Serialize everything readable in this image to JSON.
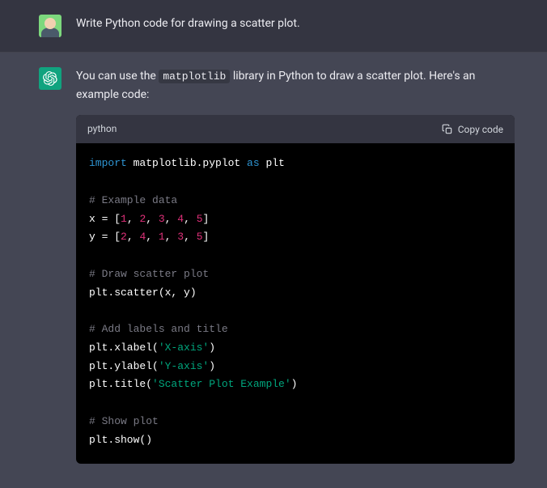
{
  "user": {
    "text": "Write Python code for drawing a scatter plot."
  },
  "assistant": {
    "intro_pre": "You can use the ",
    "intro_code": "matplotlib",
    "intro_post": " library in Python to draw a scatter plot. Here's an example code:"
  },
  "code_block": {
    "language": "python",
    "copy_label": "Copy code",
    "tokens": [
      [
        {
          "t": "import ",
          "c": "tok-keyword"
        },
        {
          "t": "matplotlib.pyplot ",
          "c": "tok-module"
        },
        {
          "t": "as ",
          "c": "tok-keyword"
        },
        {
          "t": "plt",
          "c": "tok-module"
        }
      ],
      [],
      [
        {
          "t": "# Example data",
          "c": "tok-comment"
        }
      ],
      [
        {
          "t": "x = [",
          "c": "tok-default"
        },
        {
          "t": "1",
          "c": "tok-number"
        },
        {
          "t": ", ",
          "c": "tok-default"
        },
        {
          "t": "2",
          "c": "tok-number"
        },
        {
          "t": ", ",
          "c": "tok-default"
        },
        {
          "t": "3",
          "c": "tok-number"
        },
        {
          "t": ", ",
          "c": "tok-default"
        },
        {
          "t": "4",
          "c": "tok-number"
        },
        {
          "t": ", ",
          "c": "tok-default"
        },
        {
          "t": "5",
          "c": "tok-number"
        },
        {
          "t": "]",
          "c": "tok-default"
        }
      ],
      [
        {
          "t": "y = [",
          "c": "tok-default"
        },
        {
          "t": "2",
          "c": "tok-number"
        },
        {
          "t": ", ",
          "c": "tok-default"
        },
        {
          "t": "4",
          "c": "tok-number"
        },
        {
          "t": ", ",
          "c": "tok-default"
        },
        {
          "t": "1",
          "c": "tok-number"
        },
        {
          "t": ", ",
          "c": "tok-default"
        },
        {
          "t": "3",
          "c": "tok-number"
        },
        {
          "t": ", ",
          "c": "tok-default"
        },
        {
          "t": "5",
          "c": "tok-number"
        },
        {
          "t": "]",
          "c": "tok-default"
        }
      ],
      [],
      [
        {
          "t": "# Draw scatter plot",
          "c": "tok-comment"
        }
      ],
      [
        {
          "t": "plt.scatter(x, y)",
          "c": "tok-func"
        }
      ],
      [],
      [
        {
          "t": "# Add labels and title",
          "c": "tok-comment"
        }
      ],
      [
        {
          "t": "plt.xlabel(",
          "c": "tok-func"
        },
        {
          "t": "'X-axis'",
          "c": "tok-string"
        },
        {
          "t": ")",
          "c": "tok-func"
        }
      ],
      [
        {
          "t": "plt.ylabel(",
          "c": "tok-func"
        },
        {
          "t": "'Y-axis'",
          "c": "tok-string"
        },
        {
          "t": ")",
          "c": "tok-func"
        }
      ],
      [
        {
          "t": "plt.title(",
          "c": "tok-func"
        },
        {
          "t": "'Scatter Plot Example'",
          "c": "tok-string"
        },
        {
          "t": ")",
          "c": "tok-func"
        }
      ],
      [],
      [
        {
          "t": "# Show plot",
          "c": "tok-comment"
        }
      ],
      [
        {
          "t": "plt.show()",
          "c": "tok-func"
        }
      ]
    ]
  }
}
